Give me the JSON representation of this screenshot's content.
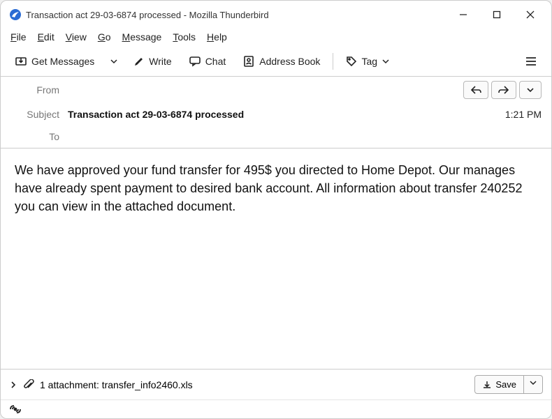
{
  "window": {
    "title": "Transaction act 29-03-6874 processed - Mozilla Thunderbird"
  },
  "menu": {
    "file": "File",
    "edit": "Edit",
    "view": "View",
    "go": "Go",
    "message": "Message",
    "tools": "Tools",
    "help": "Help"
  },
  "toolbar": {
    "get_messages": "Get Messages",
    "write": "Write",
    "chat": "Chat",
    "address_book": "Address Book",
    "tag": "Tag"
  },
  "headers": {
    "from_label": "From",
    "from_value": "",
    "subject_label": "Subject",
    "subject_value": "Transaction act 29-03-6874 processed",
    "to_label": "To",
    "to_value": "",
    "time": "1:21 PM"
  },
  "body_text": "We have approved your fund transfer for 495$ you directed to Home Depot. Our manages have already spent payment to desired bank account. All information about transfer 240252 you can view in the attached document.",
  "attachment": {
    "summary": "1 attachment: transfer_info2460.xls",
    "save": "Save"
  }
}
